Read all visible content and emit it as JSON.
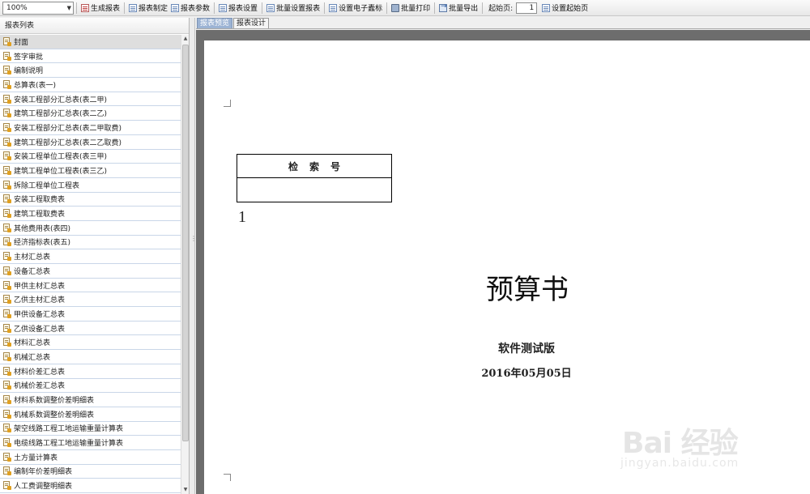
{
  "toolbar": {
    "zoom": "100%",
    "buttons": {
      "generate": "生成报表",
      "design": "报表制定",
      "params": "报表参数",
      "settings": "报表设置",
      "batch_settings": "批量设置报表",
      "e_label": "设置电子蠹标",
      "batch_print": "批量打印",
      "batch_export": "批量导出"
    },
    "start_page_label": "起始页:",
    "start_page_value": "1",
    "set_start_page": "设置起始页"
  },
  "sidebar": {
    "title": "报表列表",
    "selected_index": 0,
    "items": [
      "封面",
      "签字审批",
      "编制说明",
      "总算表(表一)",
      "安装工程部分汇总表(表二甲)",
      "建筑工程部分汇总表(表二乙)",
      "安装工程部分汇总表(表二甲取费)",
      "建筑工程部分汇总表(表二乙取费)",
      "安装工程单位工程表(表三甲)",
      "建筑工程单位工程表(表三乙)",
      "拆除工程单位工程表",
      "安装工程取费表",
      "建筑工程取费表",
      "其他费用表(表四)",
      "经济指标表(表五)",
      "主材汇总表",
      "设备汇总表",
      "甲供主材汇总表",
      "乙供主材汇总表",
      "甲供设备汇总表",
      "乙供设备汇总表",
      "材料汇总表",
      "机械汇总表",
      "材料价差汇总表",
      "机械价差汇总表",
      "材料系数调整价差明细表",
      "机械系数调整价差明细表",
      "架空线路工程工地运输重量计算表",
      "电缆线路工程工地运输重量计算表",
      "土方量计算表",
      "编制年价差明细表",
      "人工费调整明细表"
    ]
  },
  "tabs": [
    "报表预览",
    "报表设计"
  ],
  "preview": {
    "index_header": "检索号",
    "page_number": "1",
    "title": "预算书",
    "subtitle": "软件测试版",
    "date": "2016年05月05日"
  },
  "watermark": {
    "main": "Bai 经验",
    "sub": "jingyan.baidu.com"
  }
}
